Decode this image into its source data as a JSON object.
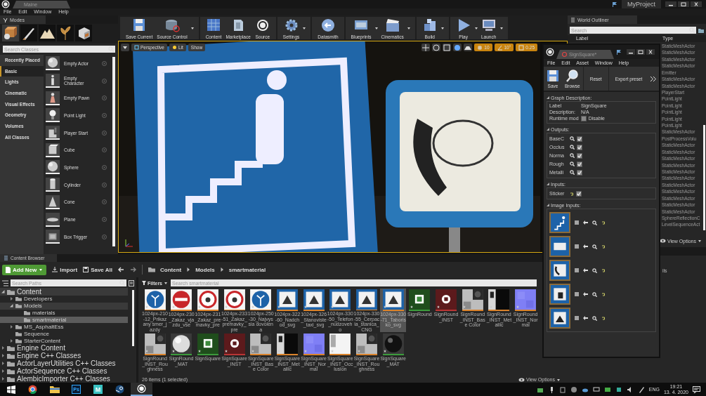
{
  "title_bar": {
    "tab": "Maine",
    "project": "MyProject"
  },
  "menu": [
    "File",
    "Edit",
    "Window",
    "Help"
  ],
  "modes": {
    "tab": "Modes",
    "search": {
      "placeholder": "Search Classes"
    },
    "categories": [
      {
        "label": "Recently Placed",
        "selected": false
      },
      {
        "label": "Basic",
        "selected": true
      },
      {
        "label": "Lights",
        "selected": false
      },
      {
        "label": "Cinematic",
        "selected": false
      },
      {
        "label": "Visual Effects",
        "selected": false
      },
      {
        "label": "Geometry",
        "selected": false
      },
      {
        "label": "Volumes",
        "selected": false
      },
      {
        "label": "All Classes",
        "selected": false
      }
    ],
    "items": [
      "Empty Actor",
      "Empty Character",
      "Empty Pawn",
      "Point Light",
      "Player Start",
      "Cube",
      "Sphere",
      "Cylinder",
      "Cone",
      "Plane",
      "Box Trigger"
    ]
  },
  "toolbar": [
    {
      "label": "Save Current",
      "dropdown": false
    },
    {
      "label": "Source Control",
      "dropdown": true
    },
    {
      "label": "Content",
      "dropdown": false
    },
    {
      "label": "Marketplace",
      "dropdown": false
    },
    {
      "label": "Source",
      "dropdown": false
    },
    {
      "label": "Settings",
      "dropdown": true
    },
    {
      "label": "Datasmith",
      "dropdown": false
    },
    {
      "label": "Blueprints",
      "dropdown": true
    },
    {
      "label": "Cinematics",
      "dropdown": true
    },
    {
      "label": "Build",
      "dropdown": true
    },
    {
      "label": "Play",
      "dropdown": true
    },
    {
      "label": "Launch",
      "dropdown": true
    }
  ],
  "viewport": {
    "view": "Perspective",
    "lighting": "Lit",
    "show": "Show",
    "grid_snap": "10",
    "rotation_snap": "10°",
    "scale_snap": "0.25"
  },
  "world_outliner": {
    "tab": "World Outliner",
    "search": {
      "placeholder": "Search"
    },
    "columns": [
      "Label",
      "Type"
    ],
    "types": [
      "StaticMeshActor",
      "StaticMeshActor",
      "StaticMeshActor",
      "StaticMeshActor",
      "Emitter",
      "StaticMeshActor",
      "StaticMeshActor",
      "PlayerStart",
      "PointLight",
      "PointLight",
      "PointLight",
      "PointLight",
      "PointLight",
      "StaticMeshActor",
      "PostProcessVolu",
      "StaticMeshActor",
      "StaticMeshActor",
      "StaticMeshActor",
      "StaticMeshActor",
      "StaticMeshActor",
      "StaticMeshActor",
      "StaticMeshActor",
      "StaticMeshActor",
      "StaticMeshActor",
      "StaticMeshActor",
      "StaticMeshActor",
      "SphereReflectionC",
      "LevelSequenceAct"
    ],
    "view_options": "View Options"
  },
  "details": {
    "text": "ils"
  },
  "content_browser": {
    "tab": "Content Browser",
    "add_new": "Add New",
    "import": "Import",
    "save_all": "Save All",
    "path": [
      "Content",
      "Models",
      "smartmaterial"
    ],
    "search_paths": {
      "placeholder": "Search Paths"
    },
    "tree": [
      {
        "label": "Content",
        "expanded": true,
        "selected": false,
        "children": [
          {
            "label": "Developers",
            "expanded": false,
            "selected": false
          },
          {
            "label": "Models",
            "expanded": true,
            "selected": false,
            "children": [
              {
                "label": "materials",
                "selected": false
              },
              {
                "label": "smartmaterial",
                "selected": true
              }
            ]
          },
          {
            "label": "MS_AsphaltEss",
            "expanded": false,
            "selected": false
          },
          {
            "label": "Sequence",
            "selected": false
          },
          {
            "label": "StarterContent",
            "expanded": false,
            "selected": false
          }
        ]
      },
      {
        "label": "Engine Content",
        "expanded": false,
        "selected": false
      },
      {
        "label": "Engine C++ Classes",
        "expanded": false,
        "selected": false
      },
      {
        "label": "ActorLayerUtilities C++ Classes",
        "expanded": false,
        "selected": false
      },
      {
        "label": "ActorSequence C++ Classes",
        "expanded": false,
        "selected": false
      },
      {
        "label": "AlembicImporter C++ Classes",
        "expanded": false,
        "selected": false
      }
    ],
    "filters": "Filters",
    "search": {
      "placeholder": "Search smartmaterial"
    },
    "assets": [
      {
        "label": "1024px-210-12_Prikazany smer_jazdy",
        "color": "#d9822b",
        "selected": false
      },
      {
        "label": "1024px-230_Zakaz_vjazdu_vse",
        "color": "#d9822b",
        "selected": false
      },
      {
        "label": "1024px-231_Zakaz_premavky_pre",
        "color": "#d9822b",
        "selected": false
      },
      {
        "label": "1024px-233-51_Zakaz_premavky_pre",
        "color": "#d9822b",
        "selected": false
      },
      {
        "label": "1024px-250-30_Najvyssia dovolena",
        "color": "#d9822b",
        "selected": false
      },
      {
        "label": "1024px-322-60_Nadchod_svg",
        "color": "#d9822b",
        "selected": false
      },
      {
        "label": "1024px-326_Stanoviste_taxi_svg",
        "color": "#d9822b",
        "selected": false
      },
      {
        "label": "1024px-330-50_Telefon_nudzoveho",
        "color": "#d9822b",
        "selected": false
      },
      {
        "label": "1024px-330-55_Cerpacia_stanica_CNG",
        "color": "#d9822b",
        "selected": false
      },
      {
        "label": "1024px-330-71_Taborisko_svg",
        "color": "#d9822b",
        "selected": true
      },
      {
        "label": "SignRound",
        "color": "#3c9a3c",
        "selected": false
      },
      {
        "label": "SignRound_INST",
        "color": "#b83535",
        "selected": false
      },
      {
        "label": "SignRound_INST_Base Color",
        "color": "#d9822b",
        "selected": false
      },
      {
        "label": "SignRound_INST_Metallic",
        "color": "#d9822b",
        "selected": false
      },
      {
        "label": "SignRound_INST_Normal",
        "color": "#d9822b",
        "selected": false
      },
      {
        "label": "SignRound_INST_Roughness",
        "color": "#d9822b",
        "selected": false
      },
      {
        "label": "SignRound_MAT",
        "color": "#3c9a3c",
        "selected": false
      },
      {
        "label": "SignSquare",
        "color": "#3c9a3c",
        "selected": false
      },
      {
        "label": "SignSquare_INST",
        "color": "#b83535",
        "selected": false
      },
      {
        "label": "SignSquare_INST_Base Color",
        "color": "#d9822b",
        "selected": false
      },
      {
        "label": "SignSquare_INST_Metallic",
        "color": "#d9822b",
        "selected": false
      },
      {
        "label": "SignSquare_INST_Normal",
        "color": "#d9822b",
        "selected": false
      },
      {
        "label": "SignSquare_INST_Occlusion",
        "color": "#d9822b",
        "selected": false
      },
      {
        "label": "SignSquare_INST_Roughness",
        "color": "#d9822b",
        "selected": false
      },
      {
        "label": "SignSquare_MAT",
        "color": "#3c9a3c",
        "selected": false
      }
    ],
    "status": "26 items (1 selected)",
    "view_options": "View Options"
  },
  "material_window": {
    "tab": "SignSquare*",
    "menu": [
      "File",
      "Edit",
      "Asset",
      "Window",
      "Help"
    ],
    "toolbar": [
      "Save",
      "Browse",
      "Reset",
      "Export preset"
    ],
    "graph_description": {
      "heading": "Graph Description:",
      "label_key": "Label",
      "label_value": "SignSquare",
      "description_key": "Description:",
      "description_value": "N/A",
      "runtime_key": "Runtime mod",
      "runtime_checked": false,
      "runtime_value": "Disable"
    },
    "outputs": {
      "heading": "Outputs:",
      "items": [
        {
          "label": "BaseC",
          "checked": true
        },
        {
          "label": "Occlus",
          "checked": true
        },
        {
          "label": "Norma",
          "checked": true
        },
        {
          "label": "Rough",
          "checked": true
        },
        {
          "label": "Metalli",
          "checked": true
        }
      ]
    },
    "inputs": {
      "heading": "Inputs:",
      "items": [
        {
          "label": "Sticker",
          "checked": true
        }
      ]
    },
    "image_inputs": {
      "heading": "Image Inputs:"
    }
  },
  "taskbar": {
    "apps": [
      {
        "kind": "start",
        "selected": false
      },
      {
        "kind": "browser",
        "selected": false
      },
      {
        "kind": "folder",
        "selected": false
      },
      {
        "kind": "ps",
        "text": "Ps",
        "selected": false
      },
      {
        "kind": "mixer",
        "text": "M",
        "selected": false
      },
      {
        "kind": "steam",
        "selected": false
      },
      {
        "kind": "unreal",
        "selected": true
      }
    ],
    "language": "ENG",
    "time": "19:21",
    "date": "13. 4. 2020"
  }
}
